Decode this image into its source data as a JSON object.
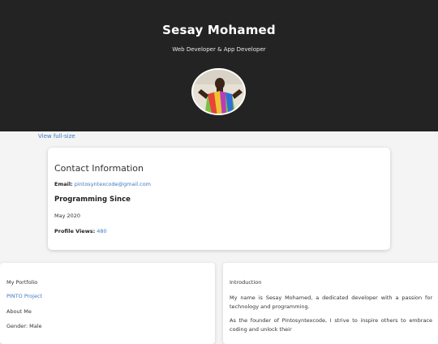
{
  "header": {
    "name": "Sesay Mohamed",
    "subtitle": "Web Developer & App Developer",
    "background_color": "#232323"
  },
  "profile_image": {
    "icon": "avatar-photo",
    "link_text": "View full-size"
  },
  "contact": {
    "title": "Contact Information",
    "email_label": "Email:",
    "email_value": "pintosyntexcode@gmail.com",
    "programming_title": "Programming Since",
    "programming_value": "May 2020",
    "views_label": "Profile Views:",
    "views_value": "480"
  },
  "left_card": {
    "portfolio_label": "My Portfolio",
    "project_link": "PINTO Project",
    "about_label": "About Me",
    "gender": "Gender: Male"
  },
  "right_card": {
    "title": "Introduction",
    "paragraph_1": "My name is Sesay Mohamed, a dedicated developer with a passion for technology and programming.",
    "paragraph_2": "As the founder of Pintosyntexcode, I strive to inspire others to embrace coding and unlock their"
  },
  "colors": {
    "link": "#3b7bbf",
    "page_background": "#f4f4f4"
  }
}
